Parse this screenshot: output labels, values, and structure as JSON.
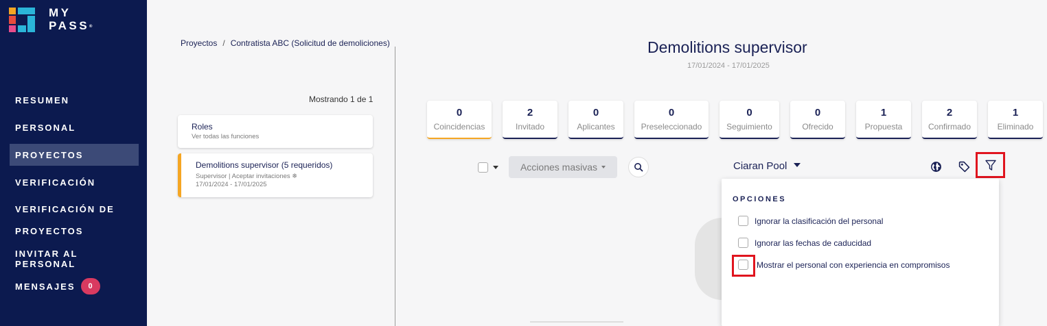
{
  "brand": {
    "line1": "MY",
    "line2": "PASS",
    "mark": "®"
  },
  "sidebar": {
    "items": [
      {
        "label": "RESUMEN"
      },
      {
        "label": "PERSONAL"
      },
      {
        "label": "PROYECTOS"
      },
      {
        "label": "VERIFICACIÓN"
      },
      {
        "label_line1": "VERIFICACIÓN DE",
        "label_line2": "PROYECTOS"
      },
      {
        "label": "INVITAR AL PERSONAL"
      },
      {
        "label": "MENSAJES",
        "badge": "0"
      }
    ]
  },
  "breadcrumb": {
    "root": "Proyectos",
    "separator": "/",
    "current": "Contratista ABC (Solicitud de demoliciones)"
  },
  "list": {
    "showing": "Mostrando 1 de 1",
    "cards": [
      {
        "title": "Roles",
        "subtitle": "Ver todas las funciones"
      },
      {
        "title": "Demolitions supervisor (5 requeridos)",
        "meta": "Supervisor | Aceptar invitaciones ❄",
        "dates": "17/01/2024 - 17/01/2025"
      }
    ]
  },
  "job": {
    "title": "Demolitions supervisor",
    "dates": "17/01/2024 - 17/01/2025"
  },
  "stats": [
    {
      "value": "0",
      "label": "Coincidencias"
    },
    {
      "value": "2",
      "label": "Invitado"
    },
    {
      "value": "0",
      "label": "Aplicantes"
    },
    {
      "value": "0",
      "label": "Preseleccionado"
    },
    {
      "value": "0",
      "label": "Seguimiento"
    },
    {
      "value": "0",
      "label": "Ofrecido"
    },
    {
      "value": "1",
      "label": "Propuesta"
    },
    {
      "value": "2",
      "label": "Confirmado"
    },
    {
      "value": "1",
      "label": "Eliminado"
    }
  ],
  "toolbar": {
    "bulk_label": "Acciones masivas",
    "user": "Ciaran Pool"
  },
  "options": {
    "title": "OPCIONES",
    "items": [
      {
        "label": "Ignorar la clasificación del personal"
      },
      {
        "label": "Ignorar las fechas de caducidad"
      },
      {
        "label": "Mostrar el personal con experiencia en compromisos"
      }
    ]
  },
  "colors": {
    "sidebar": "#0c1a4f",
    "accent": "#f5a623",
    "highlight": "#e0141e",
    "badge": "#d93a60"
  },
  "icons": [
    "globe-icon",
    "tag-icon",
    "filter-icon",
    "search-icon"
  ]
}
